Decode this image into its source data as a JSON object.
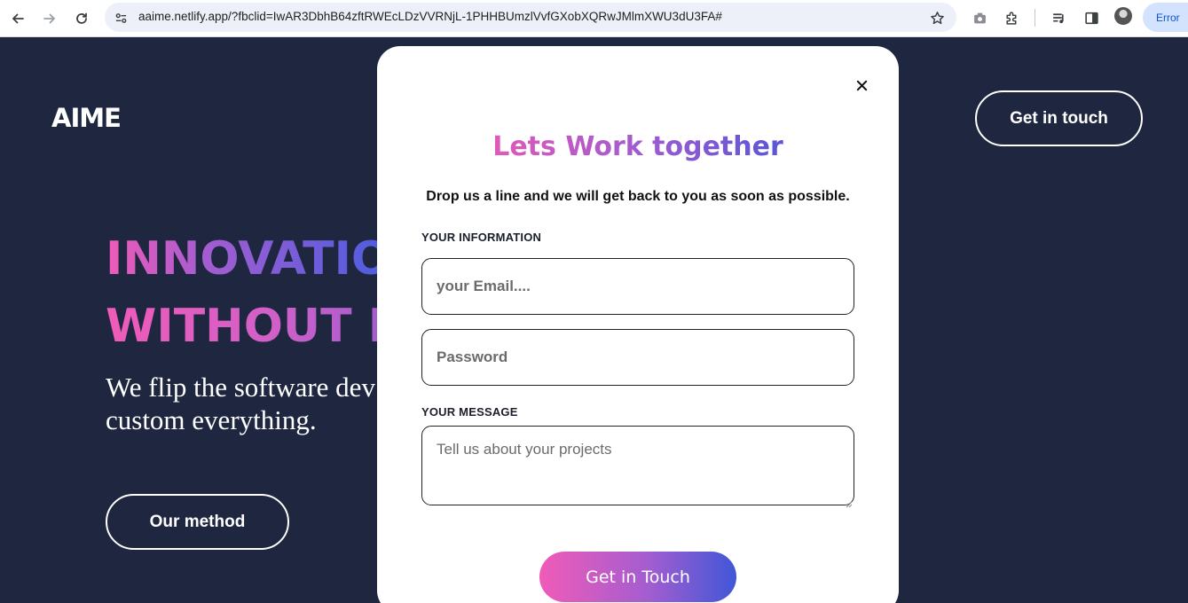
{
  "browser": {
    "url": "aaime.netlify.app/?fbclid=IwAR3DbhB64zftRWEcLDzVVRNjL-1PHHBUmzlVvfGXobXQRwJMlmXWU3dU3FA#",
    "profile_status": "Error",
    "icons": {
      "back": "back-arrow-icon",
      "forward": "forward-arrow-icon",
      "reload": "reload-icon",
      "site_settings": "site-settings-icon",
      "bookmark": "star-icon",
      "camera": "camera-icon",
      "extensions": "puzzle-icon",
      "media": "media-control-icon",
      "side_panel": "side-panel-icon"
    }
  },
  "header": {
    "logo": "AIME",
    "cta_label": "Get in touch"
  },
  "hero": {
    "line1": "INNOVATIO",
    "line2": "WITHOUT I",
    "subtitle": "We flip the software dev head and put the custom everything.",
    "method_label": "Our method"
  },
  "modal": {
    "title": "Lets Work together",
    "subtitle": "Drop us a line and we will get back to you as soon as possible.",
    "info_label": "YOUR INFORMATION",
    "email_placeholder": "your Email....",
    "password_placeholder": "Password",
    "message_label": "YOUR MESSAGE",
    "message_placeholder": "Tell us about your projects",
    "submit_label": "Get in Touch"
  },
  "colors": {
    "page_bg": "#1f2740",
    "gradient_start": "#f05bb8",
    "gradient_mid": "#a45dd0",
    "gradient_end": "#4057d8",
    "modal_bg": "#ffffff"
  }
}
